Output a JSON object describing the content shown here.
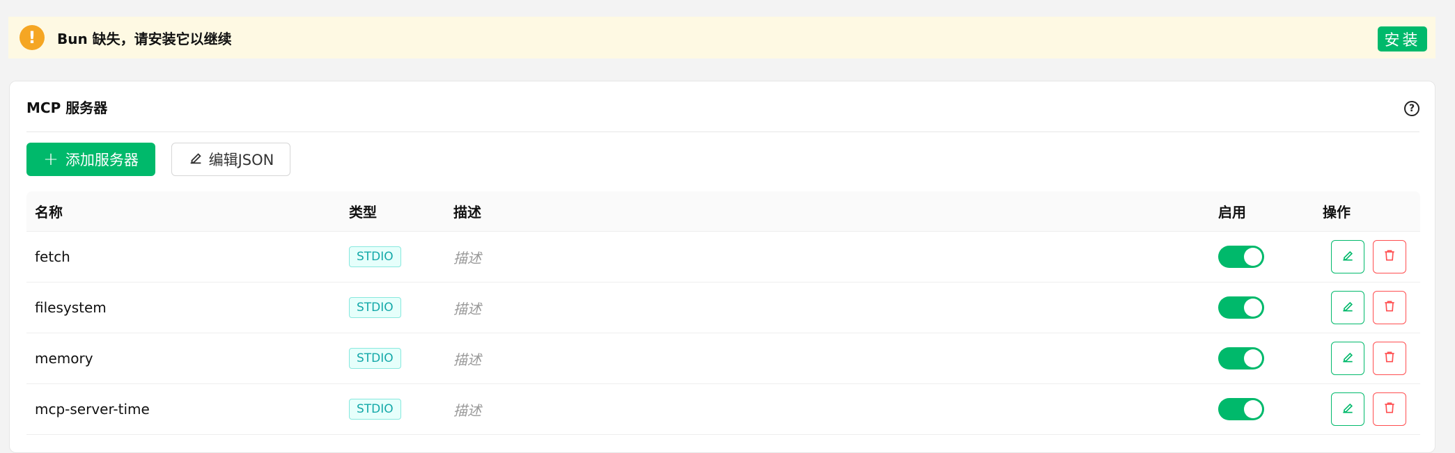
{
  "banner": {
    "icon": "exclamation-icon",
    "icon_glyph": "!",
    "message": "Bun 缺失，请安装它以继续",
    "install_label": "安装"
  },
  "card": {
    "title": "MCP 服务器",
    "help_icon": "question-circle-icon",
    "help_glyph": "?"
  },
  "toolbar": {
    "add_label": "添加服务器",
    "add_icon": "plus-icon",
    "edit_json_label": "编辑JSON",
    "edit_json_icon": "pencil-icon"
  },
  "table": {
    "columns": [
      "名称",
      "类型",
      "描述",
      "启用",
      "操作"
    ],
    "rows": [
      {
        "name": "fetch",
        "type": "STDIO",
        "description": "描述",
        "enabled": true
      },
      {
        "name": "filesystem",
        "type": "STDIO",
        "description": "描述",
        "enabled": true
      },
      {
        "name": "memory",
        "type": "STDIO",
        "description": "描述",
        "enabled": true
      },
      {
        "name": "mcp-server-time",
        "type": "STDIO",
        "description": "描述",
        "enabled": true
      }
    ]
  },
  "colors": {
    "primary": "#00b96b",
    "danger": "#ff4d4f",
    "warning": "#f5a623",
    "banner_bg": "#fef9e3",
    "tag": "#13a8a8"
  }
}
